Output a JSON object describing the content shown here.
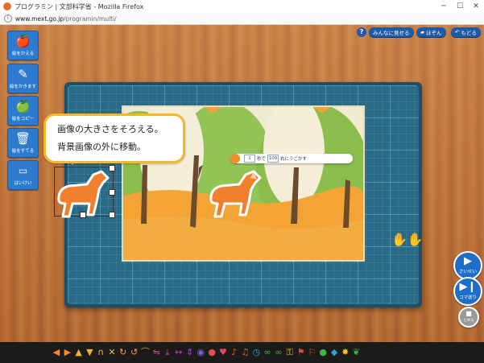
{
  "window": {
    "title": "プログラミン | 文部科学省 - Mozilla Firefox",
    "url_host": "www.mext.go.jp",
    "url_path": "/programin/multi/"
  },
  "top_buttons": {
    "help": "?",
    "show_everyone": "みんなに見せる",
    "save": "ほぞん",
    "back": "もどる"
  },
  "tools": [
    {
      "label": "絵をかえる",
      "icon": "apple-swap-icon"
    },
    {
      "label": "絵をかきます",
      "icon": "pencil-icon"
    },
    {
      "label": "絵をコピー",
      "icon": "copy-apple-icon"
    },
    {
      "label": "絵をすてる",
      "icon": "trash-icon"
    },
    {
      "label": "はいけい",
      "icon": "background-icon"
    }
  ],
  "bubble": {
    "line1": "画像の大きさをそろえる。",
    "line2": "背景画像の外に移動。"
  },
  "move_block": {
    "count": "1",
    "unit": "秒で",
    "distance": "100",
    "direction": "右にうごかす"
  },
  "controls": {
    "play": "さいせい",
    "step": "コマ送り",
    "stop": "とめる"
  },
  "colors": {
    "tool_blue": "#2c7bd1",
    "bubble_border": "#f5b82a",
    "dog_orange": "#f07f2e"
  }
}
